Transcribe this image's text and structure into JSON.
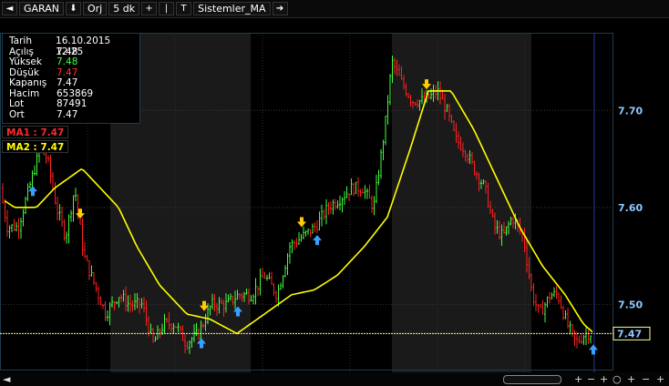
{
  "toolbar": {
    "back_icon": "◄",
    "symbol": "GARAN",
    "down_icon": "⬇",
    "orj": "Orj",
    "period": "5 dk",
    "plus_icon": "+",
    "bar_icon": "|",
    "t_icon": "T",
    "strategy": "Sistemler_MA",
    "forward_icon": "➔"
  },
  "info": {
    "rows": [
      {
        "label": "Tarih",
        "value": "16.10.2015 12:25"
      },
      {
        "label": "Açılış",
        "value": "7.48"
      },
      {
        "label": "Yüksek",
        "value": "7.48"
      },
      {
        "label": "Düşük",
        "value": "7.47"
      },
      {
        "label": "Kapanış",
        "value": "7.47"
      },
      {
        "label": "Hacim",
        "value": "653869"
      },
      {
        "label": "Lot",
        "value": "87491"
      },
      {
        "label": "Ort",
        "value": "7.47"
      }
    ]
  },
  "ma1_label": "MA1 : 7.47",
  "ma2_label": "MA2 : 7.47",
  "chart_data": {
    "type": "line",
    "ylim": [
      7.43,
      7.78
    ],
    "yticks": [
      "7.70",
      "7.60",
      "7.50"
    ],
    "last_price_label": "7.47",
    "colors": {
      "up": "#40ff40",
      "down": "#ff2020",
      "ma": "#ffff00",
      "axis_text": "#8ec8ff",
      "last": "#ffff99"
    },
    "price_anchors": [
      [
        0,
        7.62
      ],
      [
        8,
        7.58
      ],
      [
        20,
        7.58
      ],
      [
        32,
        7.62
      ],
      [
        44,
        7.66
      ],
      [
        52,
        7.65
      ],
      [
        62,
        7.6
      ],
      [
        72,
        7.57
      ],
      [
        82,
        7.62
      ],
      [
        92,
        7.55
      ],
      [
        104,
        7.52
      ],
      [
        116,
        7.49
      ],
      [
        130,
        7.51
      ],
      [
        142,
        7.5
      ],
      [
        156,
        7.5
      ],
      [
        168,
        7.46
      ],
      [
        180,
        7.48
      ],
      [
        192,
        7.48
      ],
      [
        204,
        7.46
      ],
      [
        218,
        7.47
      ],
      [
        232,
        7.5
      ],
      [
        248,
        7.5
      ],
      [
        262,
        7.51
      ],
      [
        276,
        7.51
      ],
      [
        290,
        7.53
      ],
      [
        304,
        7.51
      ],
      [
        318,
        7.56
      ],
      [
        332,
        7.57
      ],
      [
        346,
        7.58
      ],
      [
        360,
        7.6
      ],
      [
        374,
        7.61
      ],
      [
        386,
        7.62
      ],
      [
        398,
        7.62
      ],
      [
        410,
        7.6
      ],
      [
        422,
        7.68
      ],
      [
        430,
        7.75
      ],
      [
        440,
        7.73
      ],
      [
        452,
        7.71
      ],
      [
        466,
        7.71
      ],
      [
        480,
        7.72
      ],
      [
        490,
        7.7
      ],
      [
        500,
        7.67
      ],
      [
        510,
        7.66
      ],
      [
        520,
        7.64
      ],
      [
        532,
        7.62
      ],
      [
        542,
        7.58
      ],
      [
        552,
        7.57
      ],
      [
        562,
        7.59
      ],
      [
        574,
        7.57
      ],
      [
        584,
        7.51
      ],
      [
        592,
        7.49
      ],
      [
        604,
        7.51
      ],
      [
        612,
        7.51
      ],
      [
        622,
        7.48
      ],
      [
        632,
        7.46
      ],
      [
        642,
        7.47
      ],
      [
        650,
        7.47
      ]
    ],
    "ma_anchors": [
      [
        0,
        7.61
      ],
      [
        16,
        7.6
      ],
      [
        40,
        7.6
      ],
      [
        60,
        7.62
      ],
      [
        90,
        7.64
      ],
      [
        110,
        7.62
      ],
      [
        130,
        7.6
      ],
      [
        150,
        7.56
      ],
      [
        175,
        7.52
      ],
      [
        205,
        7.49
      ],
      [
        230,
        7.485
      ],
      [
        260,
        7.47
      ],
      [
        290,
        7.49
      ],
      [
        320,
        7.51
      ],
      [
        345,
        7.515
      ],
      [
        370,
        7.53
      ],
      [
        400,
        7.56
      ],
      [
        425,
        7.59
      ],
      [
        450,
        7.66
      ],
      [
        470,
        7.72
      ],
      [
        495,
        7.72
      ],
      [
        520,
        7.68
      ],
      [
        545,
        7.63
      ],
      [
        570,
        7.58
      ],
      [
        595,
        7.54
      ],
      [
        620,
        7.51
      ],
      [
        640,
        7.48
      ],
      [
        652,
        7.47
      ]
    ],
    "signals": [
      {
        "x": 36,
        "dir": "up"
      },
      {
        "x": 88,
        "dir": "down"
      },
      {
        "x": 221,
        "dir": "up"
      },
      {
        "x": 224,
        "dir": "down"
      },
      {
        "x": 261,
        "dir": "up"
      },
      {
        "x": 331,
        "dir": "down"
      },
      {
        "x": 348,
        "dir": "up"
      },
      {
        "x": 468,
        "dir": "down"
      },
      {
        "x": 651,
        "dir": "up"
      }
    ]
  },
  "bottom": {
    "left_icon": "◄",
    "right_icons": [
      "+",
      "−",
      "+",
      "○",
      "+",
      "−",
      "+"
    ]
  }
}
